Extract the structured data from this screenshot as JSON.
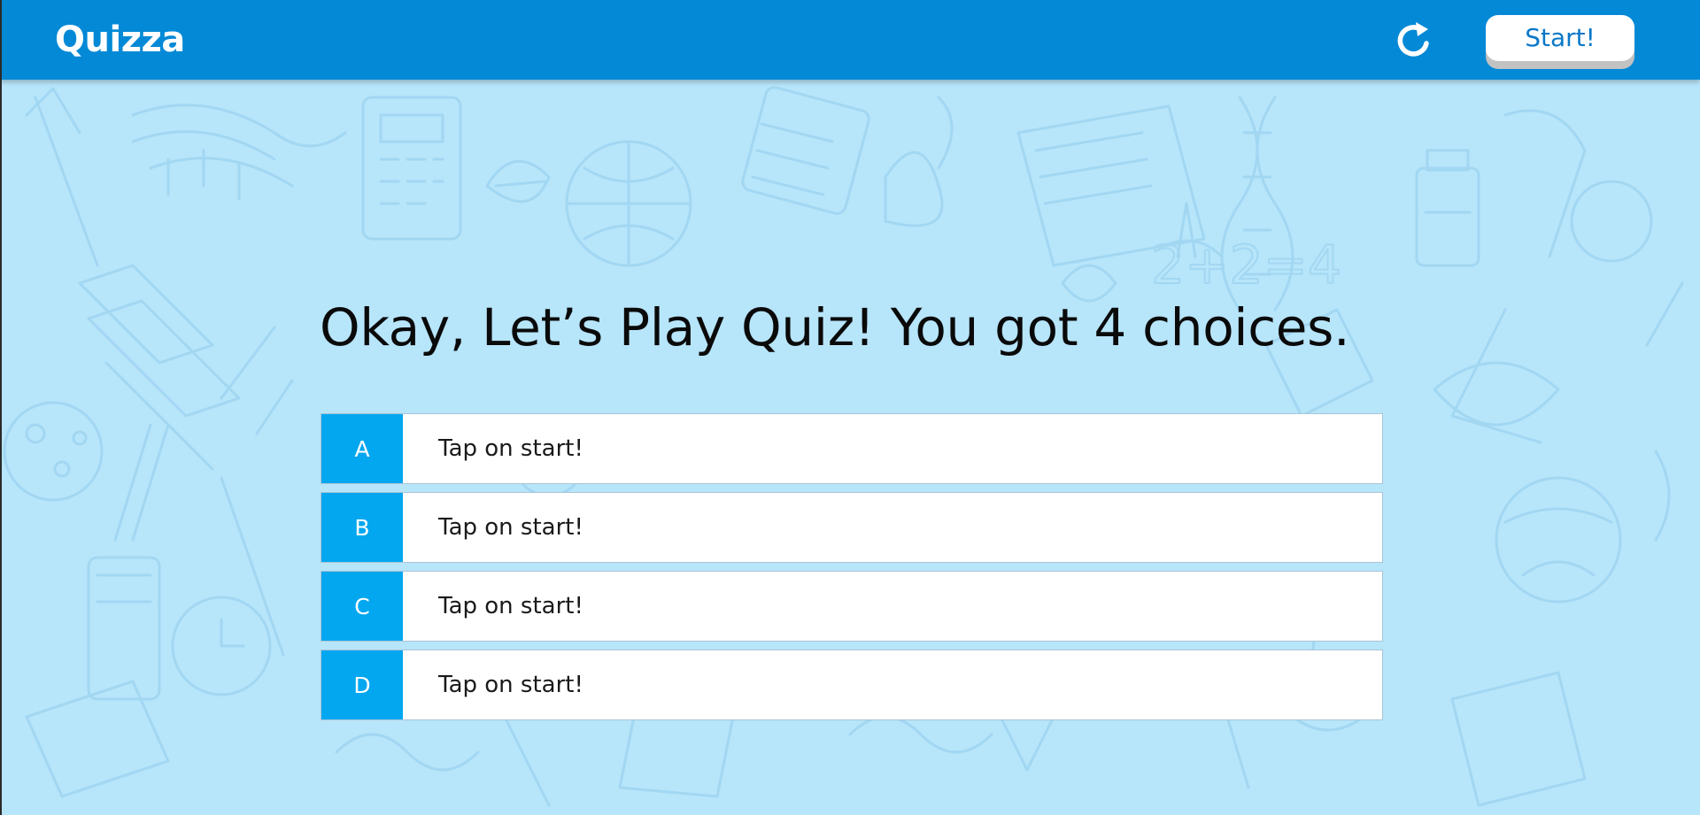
{
  "header": {
    "brand": "Quizza",
    "reset_icon": "refresh-icon",
    "start_label": "Start!"
  },
  "quiz": {
    "question": "Okay, Let’s Play Quiz! You got 4 choices.",
    "choices": [
      {
        "letter": "A",
        "text": "Tap on start!"
      },
      {
        "letter": "B",
        "text": "Tap on start!"
      },
      {
        "letter": "C",
        "text": "Tap on start!"
      },
      {
        "letter": "D",
        "text": "Tap on start!"
      }
    ]
  },
  "colors": {
    "navbar": "#0389d6",
    "background": "#b7e5fa",
    "choice_letter": "#03a7f0",
    "start_text": "#0b78c8"
  }
}
